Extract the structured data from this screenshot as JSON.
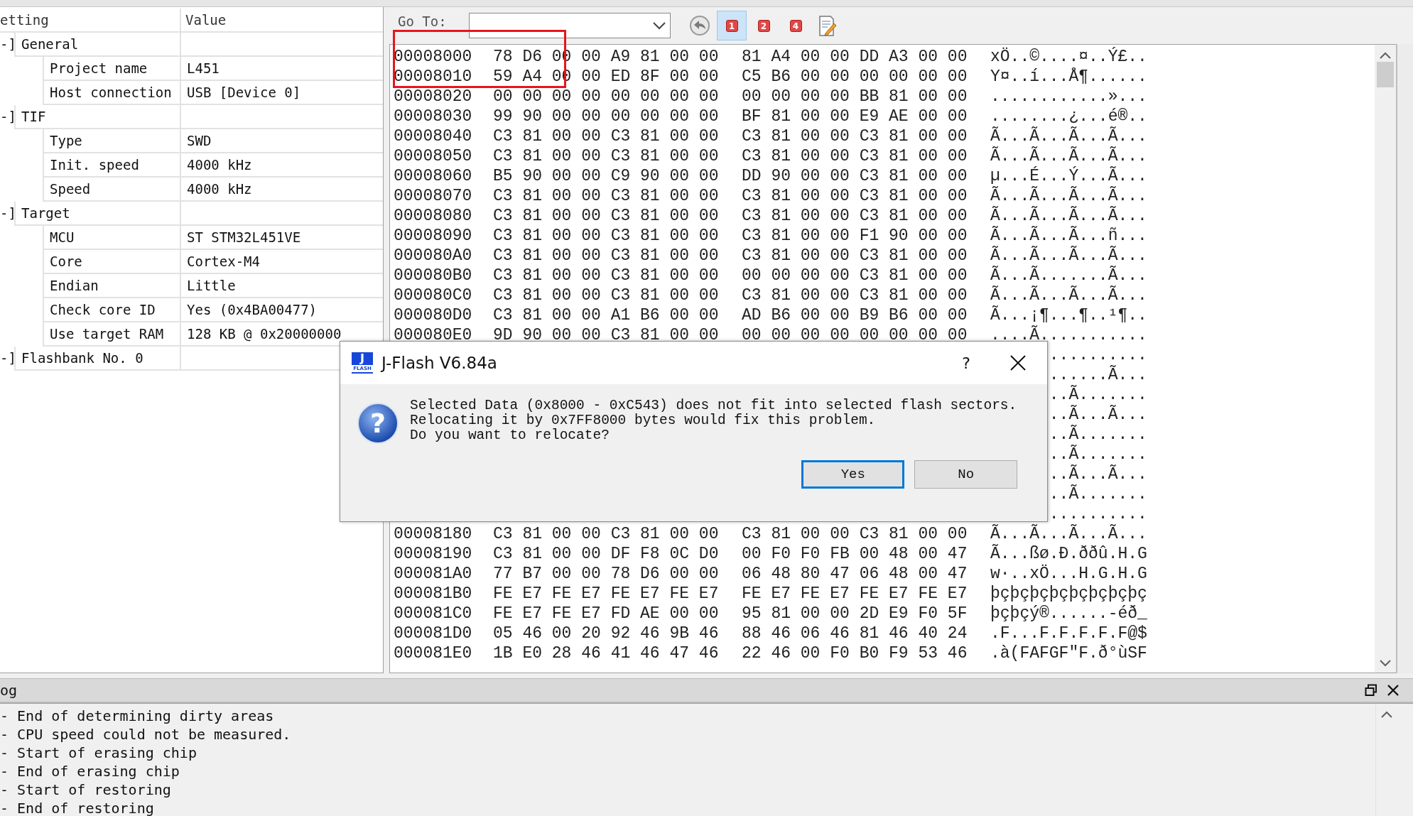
{
  "settings": {
    "columns": [
      "etting",
      "Value"
    ],
    "groups": [
      {
        "toggle": "-]",
        "label": "General",
        "children": [
          {
            "label": "Project name",
            "value": "L451"
          },
          {
            "label": "Host connection",
            "value": "USB [Device 0]"
          }
        ]
      },
      {
        "toggle": "-]",
        "label": "TIF",
        "children": [
          {
            "label": "Type",
            "value": "SWD"
          },
          {
            "label": "Init. speed",
            "value": "4000 kHz"
          },
          {
            "label": "Speed",
            "value": "4000 kHz"
          }
        ]
      },
      {
        "toggle": "-]",
        "label": "Target",
        "children": [
          {
            "label": "MCU",
            "value": "ST STM32L451VE"
          },
          {
            "label": "Core",
            "value": "Cortex-M4"
          },
          {
            "label": "Endian",
            "value": "Little"
          },
          {
            "label": "Check core ID",
            "value": "Yes (0x4BA00477)"
          },
          {
            "label": "Use target RAM",
            "value": "128 KB @ 0x20000000"
          }
        ]
      },
      {
        "toggle": "-]",
        "label": "Flashbank No. 0"
      }
    ]
  },
  "hex_view": {
    "goto_label": "Go To:",
    "toolbar": [
      {
        "kind": "back",
        "selected": false
      },
      {
        "kind": "bank",
        "label": "1",
        "selected": true
      },
      {
        "kind": "bank",
        "label": "2",
        "selected": false
      },
      {
        "kind": "bank",
        "label": "4",
        "selected": false
      },
      {
        "kind": "edit",
        "selected": false
      }
    ],
    "rows": [
      {
        "kind": "full",
        "address": "00008000",
        "bytes_1": "78 D6 00 00 A9 81 00 00",
        "bytes_2": "81 A4 00 00 DD A3 00 00",
        "ascii": "xÖ..©....¤..Ý£.."
      },
      {
        "kind": "full",
        "address": "00008010",
        "bytes_1": "59 A4 00 00 ED 8F 00 00",
        "bytes_2": "C5 B6 00 00 00 00 00 00",
        "ascii": "Y¤..í...Å¶......"
      },
      {
        "kind": "full",
        "address": "00008020",
        "bytes_1": "00 00 00 00 00 00 00 00",
        "bytes_2": "00 00 00 00 BB 81 00 00",
        "ascii": "............»..."
      },
      {
        "kind": "full",
        "address": "00008030",
        "bytes_1": "99 90 00 00 00 00 00 00",
        "bytes_2": "BF 81 00 00 E9 AE 00 00",
        "ascii": "........¿...é®.."
      },
      {
        "kind": "full",
        "address": "00008040",
        "bytes_1": "C3 81 00 00 C3 81 00 00",
        "bytes_2": "C3 81 00 00 C3 81 00 00",
        "ascii": "Ã...Ã...Ã...Ã..."
      },
      {
        "kind": "full",
        "address": "00008050",
        "bytes_1": "C3 81 00 00 C3 81 00 00",
        "bytes_2": "C3 81 00 00 C3 81 00 00",
        "ascii": "Ã...Ã...Ã...Ã..."
      },
      {
        "kind": "full",
        "address": "00008060",
        "bytes_1": "B5 90 00 00 C9 90 00 00",
        "bytes_2": "DD 90 00 00 C3 81 00 00",
        "ascii": "µ...É...Ý...Ã..."
      },
      {
        "kind": "full",
        "address": "00008070",
        "bytes_1": "C3 81 00 00 C3 81 00 00",
        "bytes_2": "C3 81 00 00 C3 81 00 00",
        "ascii": "Ã...Ã...Ã...Ã..."
      },
      {
        "kind": "full",
        "address": "00008080",
        "bytes_1": "C3 81 00 00 C3 81 00 00",
        "bytes_2": "C3 81 00 00 C3 81 00 00",
        "ascii": "Ã...Ã...Ã...Ã..."
      },
      {
        "kind": "full",
        "address": "00008090",
        "bytes_1": "C3 81 00 00 C3 81 00 00",
        "bytes_2": "C3 81 00 00 F1 90 00 00",
        "ascii": "Ã...Ã...Ã...ñ..."
      },
      {
        "kind": "full",
        "address": "000080A0",
        "bytes_1": "C3 81 00 00 C3 81 00 00",
        "bytes_2": "C3 81 00 00 C3 81 00 00",
        "ascii": "Ã...Ã...Ã...Ã..."
      },
      {
        "kind": "full",
        "address": "000080B0",
        "bytes_1": "C3 81 00 00 C3 81 00 00",
        "bytes_2": "00 00 00 00 C3 81 00 00",
        "ascii": "Ã...Ã.......Ã..."
      },
      {
        "kind": "full",
        "address": "000080C0",
        "bytes_1": "C3 81 00 00 C3 81 00 00",
        "bytes_2": "C3 81 00 00 C3 81 00 00",
        "ascii": "Ã...Ã...Ã...Ã..."
      },
      {
        "kind": "full",
        "address": "000080D0",
        "bytes_1": "C3 81 00 00 A1 B6 00 00",
        "bytes_2": "AD B6 00 00 B9 B6 00 00",
        "ascii": "Ã...¡¶...¶..¹¶.."
      },
      {
        "kind": "full",
        "address": "000080E0",
        "bytes_1": "9D 90 00 00 C3 81 00 00",
        "bytes_2": "00 00 00 00 00 00 00 00",
        "ascii": "....Ã..........."
      },
      {
        "kind": "covered",
        "ascii": ".........."
      },
      {
        "kind": "covered",
        "ascii": "......Ã..."
      },
      {
        "kind": "covered",
        "ascii": "..Ã......."
      },
      {
        "kind": "covered",
        "ascii": "..Ã...Ã..."
      },
      {
        "kind": "covered",
        "ascii": "..Ã......."
      },
      {
        "kind": "covered",
        "ascii": "..Ã......."
      },
      {
        "kind": "covered",
        "ascii": "..Ã...Ã..."
      },
      {
        "kind": "covered",
        "ascii": "..Ã......."
      },
      {
        "kind": "covered",
        "ascii": ".........."
      },
      {
        "kind": "full",
        "address": "00008180",
        "bytes_1": "C3 81 00 00 C3 81 00 00",
        "bytes_2": "C3 81 00 00 C3 81 00 00",
        "ascii": "Ã...Ã...Ã...Ã..."
      },
      {
        "kind": "full",
        "address": "00008190",
        "bytes_1": "C3 81 00 00 DF F8 0C D0",
        "bytes_2": "00 F0 F0 FB 00 48 00 47",
        "ascii": "Ã...ßø.Ð.ððû.H.G"
      },
      {
        "kind": "full",
        "address": "000081A0",
        "bytes_1": "77 B7 00 00 78 D6 00 00",
        "bytes_2": "06 48 80 47 06 48 00 47",
        "ascii": "w·..xÖ...H.G.H.G"
      },
      {
        "kind": "full",
        "address": "000081B0",
        "bytes_1": "FE E7 FE E7 FE E7 FE E7",
        "bytes_2": "FE E7 FE E7 FE E7 FE E7",
        "ascii": "þçþçþçþçþçþçþçþç"
      },
      {
        "kind": "full",
        "address": "000081C0",
        "bytes_1": "FE E7 FE E7 FD AE 00 00",
        "bytes_2": "95 81 00 00 2D E9 F0 5F",
        "ascii": "þçþçý®......-éð_"
      },
      {
        "kind": "full",
        "address": "000081D0",
        "bytes_1": "05 46 00 20 92 46 9B 46",
        "bytes_2": "88 46 06 46 81 46 40 24",
        "ascii": ".F...F.F.F.F.F@$"
      },
      {
        "kind": "full",
        "address": "000081E0",
        "bytes_1": "1B E0 28 46 41 46 47 46",
        "bytes_2": "22 46 00 F0 B0 F9 53 46",
        "ascii": ".à(FAFGF\"F.ð°ùSF"
      }
    ]
  },
  "log": {
    "title": "og",
    "lines": [
      "- End of determining dirty areas",
      "- CPU speed could not be measured.",
      "- Start of erasing chip",
      "- End of erasing chip",
      "- Start of restoring",
      "- End of restoring"
    ]
  },
  "dialog": {
    "icon_letter": "J",
    "icon_caption": "FLASH",
    "title": "J-Flash V6.84a",
    "help": "?",
    "question_glyph": "?",
    "message_lines": [
      "Selected Data (0x8000 - 0xC543) does not fit into selected flash sectors.",
      "Relocating it by 0x7FF8000 bytes would fix this problem.",
      "Do you want to relocate?"
    ],
    "buttons": [
      {
        "label": "Yes",
        "focused": true
      },
      {
        "label": "No",
        "focused": false
      }
    ]
  }
}
